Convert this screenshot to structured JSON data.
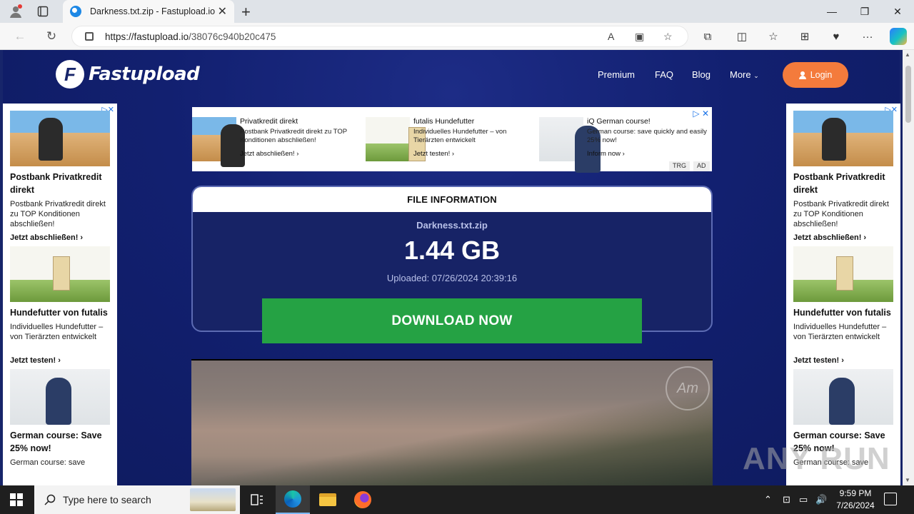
{
  "browser": {
    "tab_title": "Darkness.txt.zip - Fastupload.io",
    "url_host": "https://fastupload.io",
    "url_path": "/38076c940b20c475",
    "icons": [
      "profile-icon",
      "tab-actions-icon",
      "back-icon",
      "refresh-icon",
      "lock-icon",
      "read-aloud-icon",
      "immersive-reader-icon",
      "favorite-star-icon",
      "extensions-icon",
      "split-screen-icon",
      "favorites-icon",
      "collections-icon",
      "performance-icon",
      "more-icon",
      "copilot-icon"
    ]
  },
  "site": {
    "logo_text": "Fastupload",
    "nav": [
      "Premium",
      "FAQ",
      "Blog",
      "More"
    ],
    "login_label": "Login",
    "accent_color": "#f47b3c",
    "download_color": "#25a244"
  },
  "top_ad": {
    "items": [
      {
        "title": "Privatkredit direkt",
        "body": "Postbank Privatkredit direkt zu TOP Konditionen abschließen!",
        "cta": "Jetzt abschließen! ›"
      },
      {
        "title": "futalis Hundefutter",
        "body": "Individuelles Hundefutter – von Tierärzten entwickelt",
        "cta": "Jetzt testen! ›"
      },
      {
        "title": "iQ German course!",
        "body": "German course: save quickly and easily 25% now!",
        "cta": "Inform now ›"
      }
    ],
    "tags": [
      "TRG",
      "AD"
    ]
  },
  "side_ads": [
    {
      "title": "Postbank Privatkredit direkt",
      "body": "Postbank Privatkredit direkt zu TOP Konditionen abschließen!",
      "cta": "Jetzt abschließen! ›"
    },
    {
      "title": "Hundefutter von futalis",
      "body": "Individuelles Hundefutter – von Tierärzten entwickelt",
      "cta": "Jetzt testen! ›"
    },
    {
      "title": "German course: Save 25% now!",
      "body": "German course: save",
      "cta": ""
    }
  ],
  "file": {
    "header": "FILE INFORMATION",
    "name": "Darkness.txt.zip",
    "size": "1.44 GB",
    "uploaded": "Uploaded: 07/26/2024 20:39:16",
    "download_label": "DOWNLOAD NOW"
  },
  "watermark": "ANY RUN",
  "taskbar": {
    "search_placeholder": "Type here to search",
    "time": "9:59 PM",
    "date": "7/26/2024"
  }
}
